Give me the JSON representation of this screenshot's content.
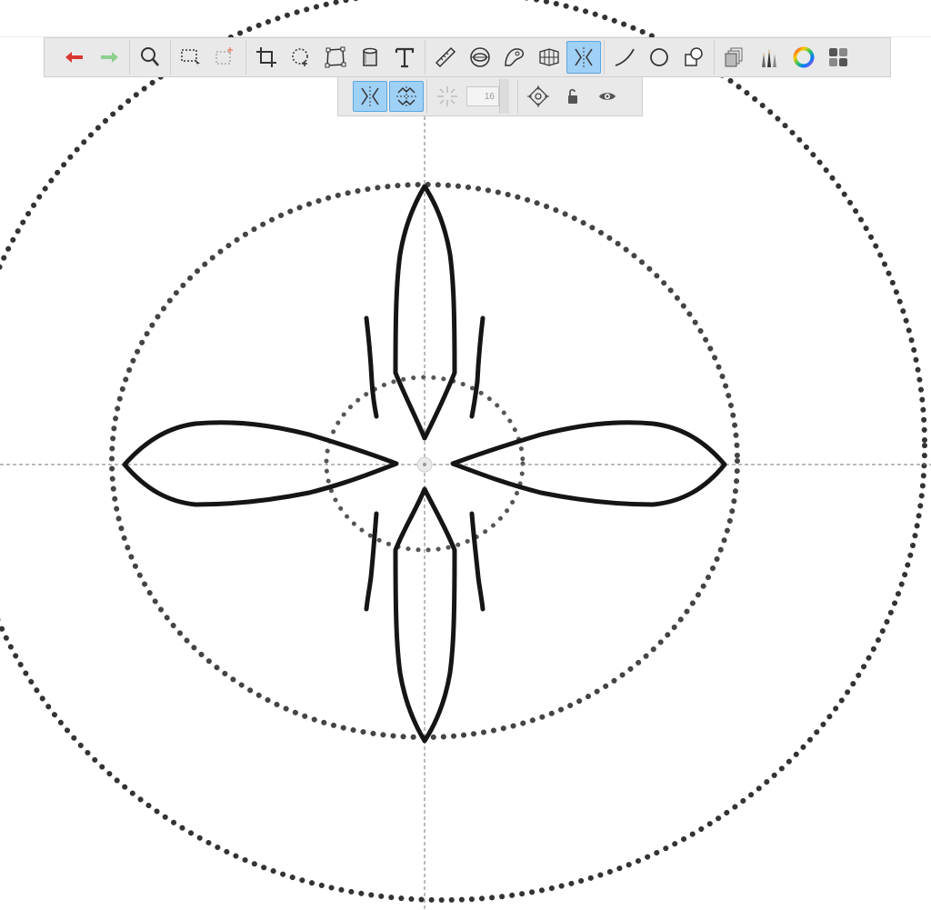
{
  "app": {
    "accent": "#9fd0f5",
    "accent_border": "#5aa6e0"
  },
  "toolbar": {
    "tools": [
      {
        "name": "undo-icon",
        "color": "#d9382f"
      },
      {
        "name": "redo-icon",
        "color": "#8ed08e"
      },
      {
        "name": "magnifier-icon"
      },
      {
        "name": "selection-icon"
      },
      {
        "name": "selection-add-icon",
        "color": "#e58a6a"
      },
      {
        "name": "crop-icon"
      },
      {
        "name": "lasso-icon"
      },
      {
        "name": "transform-icon"
      },
      {
        "name": "fill-bucket-icon"
      },
      {
        "name": "text-icon",
        "label": "T"
      },
      {
        "name": "ruler-icon"
      },
      {
        "name": "ellipse-guide-icon"
      },
      {
        "name": "french-curve-icon"
      },
      {
        "name": "perspective-icon"
      },
      {
        "name": "symmetry-icon",
        "active": true
      },
      {
        "name": "stroke-icon"
      },
      {
        "name": "circle-shape-icon"
      },
      {
        "name": "shape-combine-icon"
      },
      {
        "name": "layers-icon"
      },
      {
        "name": "brushes-icon"
      },
      {
        "name": "color-wheel-icon"
      },
      {
        "name": "grid-menu-icon"
      }
    ]
  },
  "symmetry_bar": {
    "modes": [
      {
        "name": "vertical-symmetry-icon",
        "active": true
      },
      {
        "name": "four-way-symmetry-icon",
        "active": true
      },
      {
        "name": "radial-symmetry-icon",
        "active": false
      }
    ],
    "sector_count": "16",
    "extra": [
      {
        "name": "symmetry-center-icon"
      },
      {
        "name": "unlock-icon"
      },
      {
        "name": "visibility-eye-icon"
      }
    ]
  }
}
